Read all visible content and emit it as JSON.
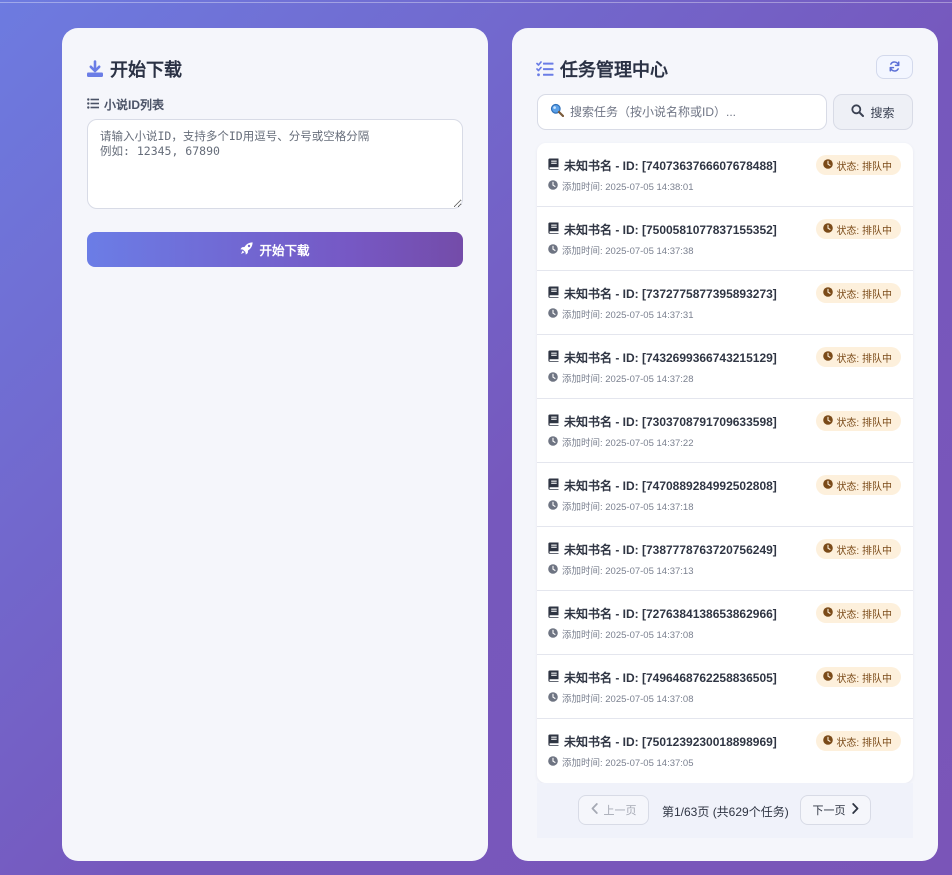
{
  "download_panel": {
    "title": "开始下载",
    "ids_label": "小说ID列表",
    "ids_placeholder": "请输入小说ID，支持多个ID用逗号、分号或空格分隔\n例如: 12345, 67890",
    "submit_label": "开始下载"
  },
  "task_panel": {
    "title": "任务管理中心",
    "search_placeholder": "搜索任务（按小说名称或ID）...",
    "search_button": "搜索",
    "tasks": [
      {
        "title": "未知书名 - ID: [7407363766607678488]",
        "time": "添加时间: 2025-07-05 14:38:01",
        "status": "状态: 排队中"
      },
      {
        "title": "未知书名 - ID: [7500581077837155352]",
        "time": "添加时间: 2025-07-05 14:37:38",
        "status": "状态: 排队中"
      },
      {
        "title": "未知书名 - ID: [7372775877395893273]",
        "time": "添加时间: 2025-07-05 14:37:31",
        "status": "状态: 排队中"
      },
      {
        "title": "未知书名 - ID: [7432699366743215129]",
        "time": "添加时间: 2025-07-05 14:37:28",
        "status": "状态: 排队中"
      },
      {
        "title": "未知书名 - ID: [7303708791709633598]",
        "time": "添加时间: 2025-07-05 14:37:22",
        "status": "状态: 排队中"
      },
      {
        "title": "未知书名 - ID: [7470889284992502808]",
        "time": "添加时间: 2025-07-05 14:37:18",
        "status": "状态: 排队中"
      },
      {
        "title": "未知书名 - ID: [7387778763720756249]",
        "time": "添加时间: 2025-07-05 14:37:13",
        "status": "状态: 排队中"
      },
      {
        "title": "未知书名 - ID: [7276384138653862966]",
        "time": "添加时间: 2025-07-05 14:37:08",
        "status": "状态: 排队中"
      },
      {
        "title": "未知书名 - ID: [7496468762258836505]",
        "time": "添加时间: 2025-07-05 14:37:08",
        "status": "状态: 排队中"
      },
      {
        "title": "未知书名 - ID: [7501239230018898969]",
        "time": "添加时间: 2025-07-05 14:37:05",
        "status": "状态: 排队中"
      }
    ],
    "pagination": {
      "prev_label": "上一页",
      "info": "第1/63页 (共629个任务)",
      "next_label": "下一页"
    }
  },
  "colors": {
    "accent": "#6b7de6",
    "accent_end": "#744ca9",
    "status_badge_bg": "#fdf0dc",
    "status_badge_text": "#7a4a18"
  },
  "icons": {
    "download_title": "download-icon",
    "list_label": "list-icon",
    "submit": "rocket-icon",
    "task_title": "tasks-icon",
    "refresh": "refresh-icon",
    "search": "magnifier-icon",
    "book": "book-icon",
    "clock": "clock-icon",
    "prev": "chevron-left-icon",
    "next": "chevron-right-icon"
  }
}
